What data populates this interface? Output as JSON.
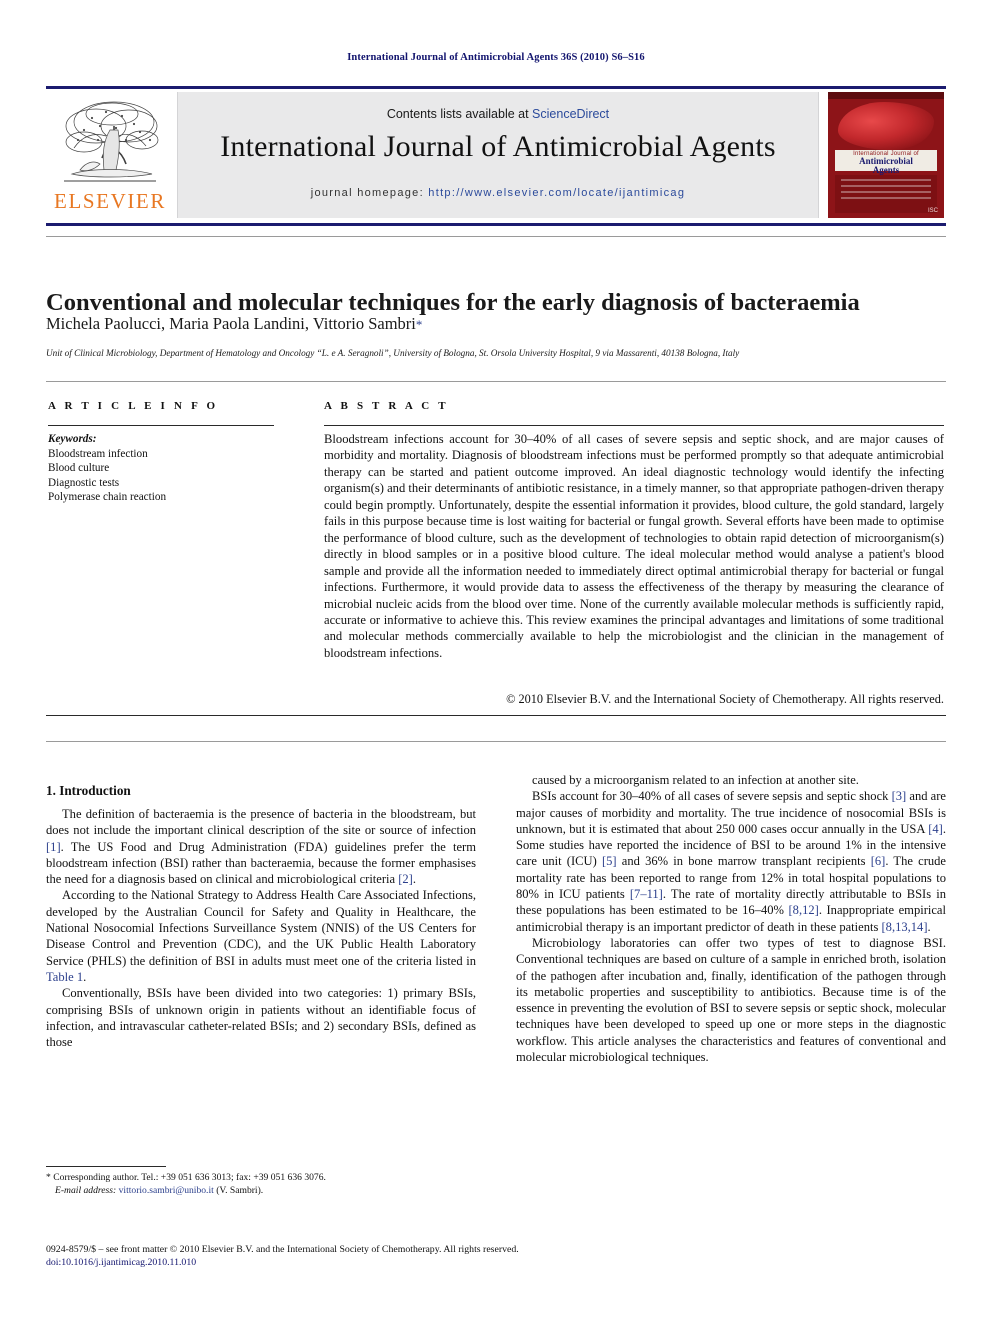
{
  "running_head": "International Journal of Antimicrobial Agents 36S (2010) S6–S16",
  "masthead": {
    "publisher_name": "ELSEVIER",
    "contents_prefix": "Contents lists available at ",
    "contents_link": "ScienceDirect",
    "journal_title": "International Journal of Antimicrobial Agents",
    "homepage_prefix": "journal homepage: ",
    "homepage_url": "http://www.elsevier.com/locate/ijantimicag",
    "cover": {
      "line1": "International Journal of",
      "line2": "Antimicrobial",
      "line3": "Agents",
      "badge": "ISC"
    }
  },
  "article": {
    "title": "Conventional and molecular techniques for the early diagnosis of bacteraemia",
    "authors": "Michela Paolucci, Maria Paola Landini, Vittorio Sambri",
    "corresponding_marker": "*",
    "affiliation": "Unit of Clinical Microbiology, Department of Hematology and Oncology “L. e A. Seragnoli”, University of Bologna, St. Orsola University Hospital, 9 via Massarenti, 40138 Bologna, Italy"
  },
  "article_info": {
    "heading": "A R T I C L E   I N F O",
    "keywords_label": "Keywords:",
    "keywords": [
      "Bloodstream infection",
      "Blood culture",
      "Diagnostic tests",
      "Polymerase chain reaction"
    ]
  },
  "abstract": {
    "heading": "A B S T R A C T",
    "text": "Bloodstream infections account for 30–40% of all cases of severe sepsis and septic shock, and are major causes of morbidity and mortality. Diagnosis of bloodstream infections must be performed promptly so that adequate antimicrobial therapy can be started and patient outcome improved. An ideal diagnostic technology would identify the infecting organism(s) and their determinants of antibiotic resistance, in a timely manner, so that appropriate pathogen-driven therapy could begin promptly. Unfortunately, despite the essential information it provides, blood culture, the gold standard, largely fails in this purpose because time is lost waiting for bacterial or fungal growth. Several efforts have been made to optimise the performance of blood culture, such as the development of technologies to obtain rapid detection of microorganism(s) directly in blood samples or in a positive blood culture. The ideal molecular method would analyse a patient's blood sample and provide all the information needed to immediately direct optimal antimicrobial therapy for bacterial or fungal infections. Furthermore, it would provide data to assess the effectiveness of the therapy by measuring the clearance of microbial nucleic acids from the blood over time. None of the currently available molecular methods is sufficiently rapid, accurate or informative to achieve this. This review examines the principal advantages and limitations of some traditional and molecular methods commercially available to help the microbiologist and the clinician in the management of bloodstream infections.",
    "copyright": "© 2010 Elsevier B.V. and the International Society of Chemotherapy. All rights reserved."
  },
  "body": {
    "section_number_title": "1. Introduction",
    "left_paragraphs": [
      "The definition of bacteraemia is the presence of bacteria in the bloodstream, but does not include the important clinical description of the site or source of infection [1]. The US Food and Drug Administration (FDA) guidelines prefer the term bloodstream infection (BSI) rather than bacteraemia, because the former emphasises the need for a diagnosis based on clinical and microbiological criteria [2].",
      "According to the National Strategy to Address Health Care Associated Infections, developed by the Australian Council for Safety and Quality in Healthcare, the National Nosocomial Infections Surveillance System (NNIS) of the US Centers for Disease Control and Prevention (CDC), and the UK Public Health Laboratory Service (PHLS) the definition of BSI in adults must meet one of the criteria listed in Table 1.",
      "Conventionally, BSIs have been divided into two categories: 1) primary BSIs, comprising BSIs of unknown origin in patients without an identifiable focus of infection, and intravascular catheter-related BSIs; and 2) secondary BSIs, defined as those"
    ],
    "right_paragraphs": [
      "caused by a microorganism related to an infection at another site.",
      "BSIs account for 30–40% of all cases of severe sepsis and septic shock [3] and are major causes of morbidity and mortality. The true incidence of nosocomial BSIs is unknown, but it is estimated that about 250 000 cases occur annually in the USA [4]. Some studies have reported the incidence of BSI to be around 1% in the intensive care unit (ICU) [5] and 36% in bone marrow transplant recipients [6]. The crude mortality rate has been reported to range from 12% in total hospital populations to 80% in ICU patients [7–11]. The rate of mortality directly attributable to BSIs in these populations has been estimated to be 16–40% [8,12]. Inappropriate empirical antimicrobial therapy is an important predictor of death in these patients [8,13,14].",
      "Microbiology laboratories can offer two types of test to diagnose BSI. Conventional techniques are based on culture of a sample in enriched broth, isolation of the pathogen after incubation and, finally, identification of the pathogen through its metabolic properties and susceptibility to antibiotics. Because time is of the essence in preventing the evolution of BSI to severe sepsis or septic shock, molecular techniques have been developed to speed up one or more steps in the diagnostic workflow. This article analyses the characteristics and features of conventional and molecular microbiological techniques."
    ],
    "inline_links_left": [
      "[1]",
      "[2]",
      "Table 1"
    ],
    "inline_links_right": [
      "[3]",
      "[4]",
      "[5]",
      "[6]",
      "[7–11]",
      "[8,12]",
      "[8,13,14]"
    ]
  },
  "footnote": {
    "marker": "*",
    "corresponding": "Corresponding author. Tel.: +39 051 636 3013; fax: +39 051 636 3076.",
    "email_label": "E-mail address:",
    "email": "vittorio.sambri@unibo.it",
    "email_suffix": "(V. Sambri)."
  },
  "footer": {
    "issn_line": "0924-8579/$ – see front matter © 2010 Elsevier B.V. and the International Society of Chemotherapy. All rights reserved.",
    "doi_line": "doi:10.1016/j.ijantimicag.2010.11.010"
  },
  "colors": {
    "running_head": "#12146e",
    "link_blue": "#2b4a9b",
    "reference_blue": "#2b3f8c",
    "elsevier_orange": "#e87722",
    "rule_navy": "#1b1b6f",
    "band_gray": "#e9e9ea",
    "cover_red": "#8d1418"
  }
}
